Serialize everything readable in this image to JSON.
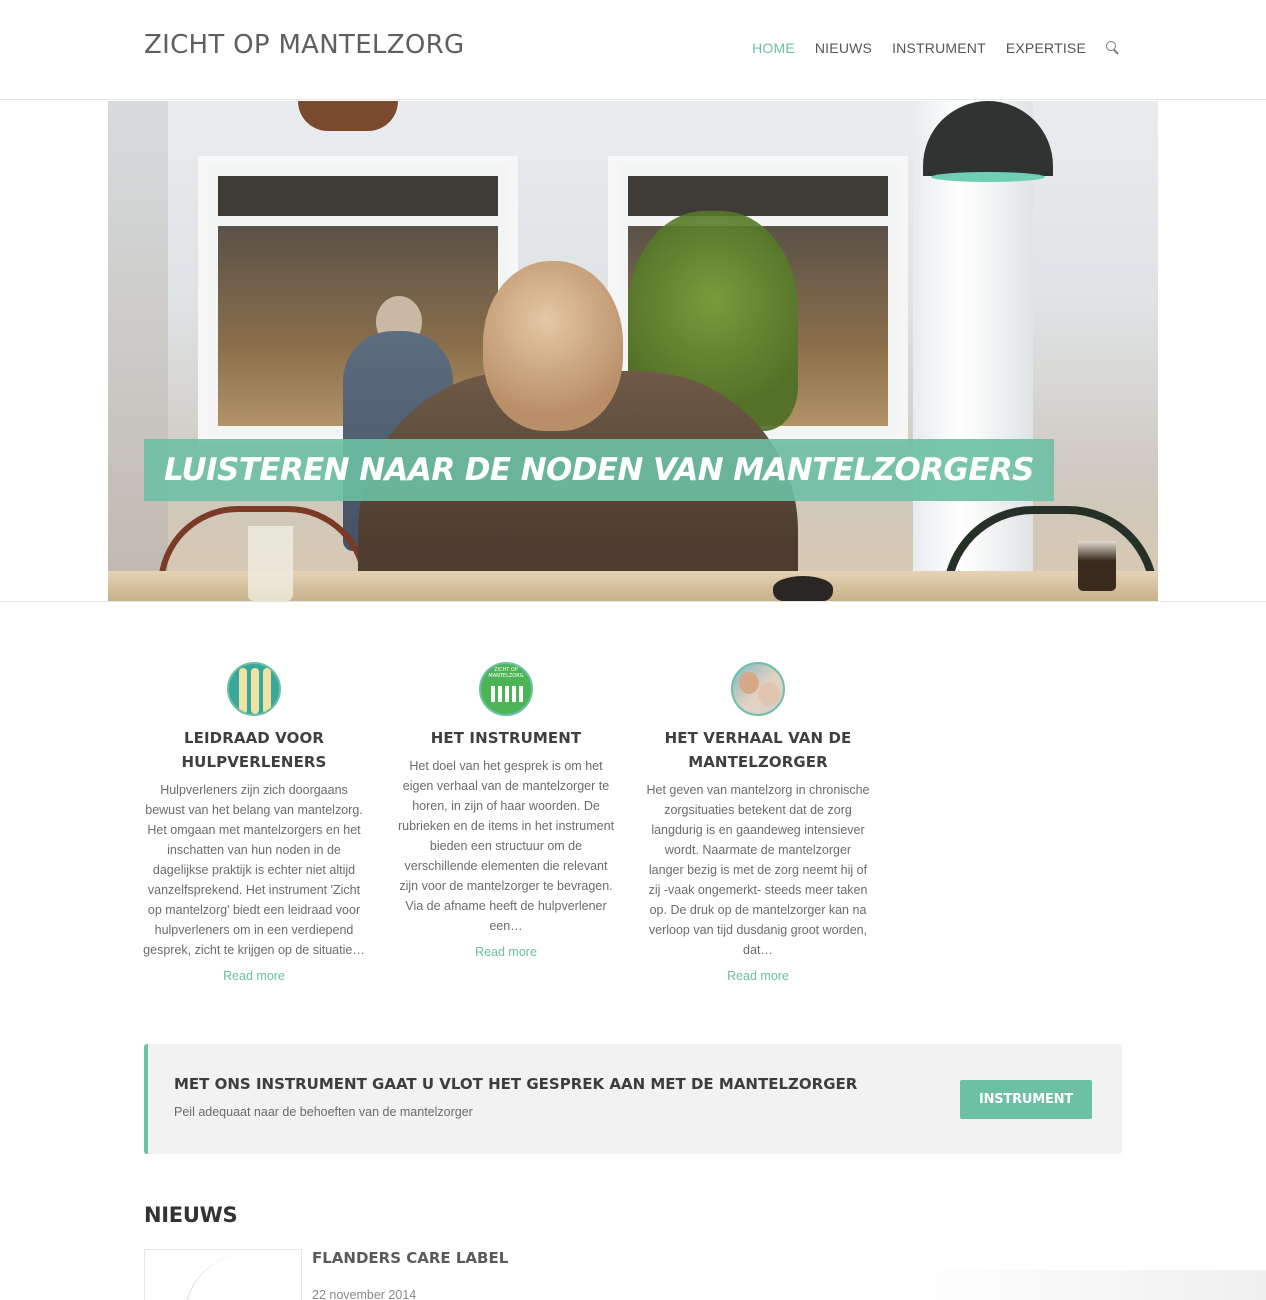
{
  "site": {
    "logo": "ZICHT OP MANTELZORG"
  },
  "nav": {
    "items": [
      {
        "label": "HOME",
        "active": true
      },
      {
        "label": "NIEUWS",
        "active": false
      },
      {
        "label": "INSTRUMENT",
        "active": false
      },
      {
        "label": "EXPERTISE",
        "active": false
      }
    ],
    "search_icon": "search-icon"
  },
  "hero": {
    "caption": "LUISTEREN NAAR DE NODEN VAN MANTELZORGERS"
  },
  "features": [
    {
      "title": "LEIDRAAD VOOR HULPVERLENERS",
      "text": "Hulpverleners zijn zich doorgaans bewust van het belang van mantelzorg. Het omgaan met mantelzorgers en het inschatten van hun noden in de dagelijkse praktijk is echter niet altijd vanzelfsprekend. Het instrument 'Zicht op mantelzorg' biedt een leidraad voor hulpverleners om in een verdiepend gesprek, zicht te krijgen op de situatie…",
      "link": "Read more"
    },
    {
      "title": "HET INSTRUMENT",
      "image_text": "ZICHT OP MANTELZORG",
      "text": "Het doel van het gesprek is om het eigen verhaal van de mantelzorger te horen, in zijn of haar woorden. De rubrieken en de items in het instrument bieden een structuur om de verschillende elementen die relevant zijn voor de mantelzorger te bevragen. Via de afname heeft de hulpverlener een…",
      "link": "Read more"
    },
    {
      "title": "HET VERHAAL VAN DE MANTELZORGER",
      "text": "Het geven van mantelzorg in chronische zorgsituaties betekent dat de zorg langdurig is en gaandeweg intensiever wordt. Naarmate de mantelzorger langer bezig is met de zorg neemt hij of zij -vaak ongemerkt- steeds meer taken op. De druk op de mantelzorger kan na verloop van tijd dusdanig groot worden, dat…",
      "link": "Read more"
    }
  ],
  "cta": {
    "title": "MET ONS INSTRUMENT GAAT U VLOT HET GESPREK AAN MET DE MANTELZORGER",
    "subtitle": "Peil adequaat naar de behoeften van de mantelzorger",
    "button": "INSTRUMENT"
  },
  "news": {
    "heading": "NIEUWS",
    "items": [
      {
        "title": "FLANDERS CARE LABEL",
        "date": "22 november 2014"
      }
    ]
  },
  "colors": {
    "accent": "#6cc0a4",
    "text": "#555555",
    "cta_bg": "#f2f2f2"
  }
}
